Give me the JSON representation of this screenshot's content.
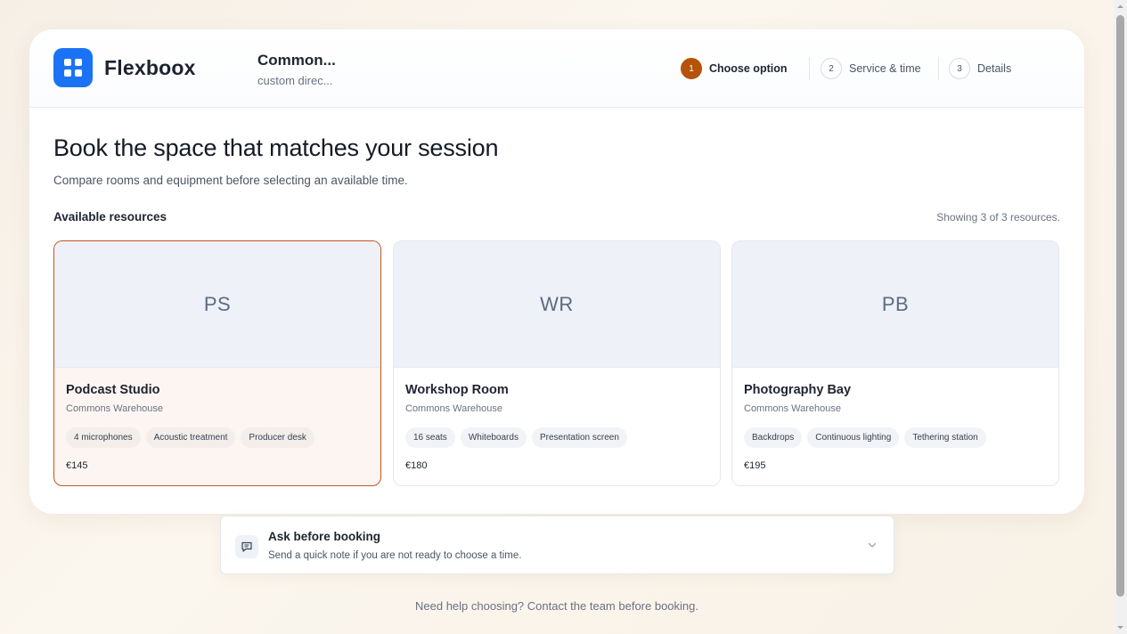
{
  "brand": {
    "name": "Flexboox"
  },
  "organization": {
    "title": "Common...",
    "subtitle": "custom direc..."
  },
  "steps": [
    {
      "num": "1",
      "label": "Choose option",
      "active": true
    },
    {
      "num": "2",
      "label": "Service & time",
      "active": false
    },
    {
      "num": "3",
      "label": "Details",
      "active": false
    }
  ],
  "main": {
    "heading": "Book the space that matches your session",
    "lead": "Compare rooms and equipment before selecting an available time.",
    "section_title": "Available resources",
    "showing": "Showing 3 of 3 resources."
  },
  "resources": [
    {
      "initials": "PS",
      "name": "Podcast Studio",
      "location": "Commons Warehouse",
      "tags": [
        "4 microphones",
        "Acoustic treatment",
        "Producer desk"
      ],
      "price": "€145",
      "selected": true
    },
    {
      "initials": "WR",
      "name": "Workshop Room",
      "location": "Commons Warehouse",
      "tags": [
        "16 seats",
        "Whiteboards",
        "Presentation screen"
      ],
      "price": "€180",
      "selected": false
    },
    {
      "initials": "PB",
      "name": "Photography Bay",
      "location": "Commons Warehouse",
      "tags": [
        "Backdrops",
        "Continuous lighting",
        "Tethering station"
      ],
      "price": "€195",
      "selected": false
    }
  ],
  "ask": {
    "title": "Ask before booking",
    "subtitle": "Send a quick note if you are not ready to choose a time.",
    "icon": "message-icon"
  },
  "footer": {
    "help": "Need help choosing? Contact the team before booking."
  },
  "colors": {
    "accent": "#b45309",
    "brand": "#1a73f5",
    "selected_border": "#c2561b"
  }
}
